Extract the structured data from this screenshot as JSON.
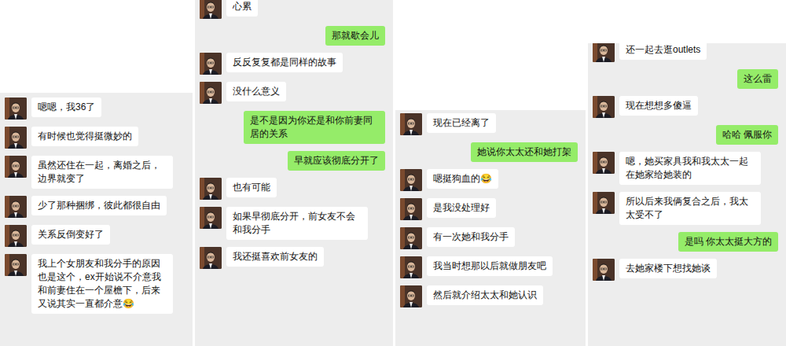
{
  "panels": [
    {
      "messages": [
        {
          "text": "嗯嗯，我36了",
          "kind": "received"
        },
        {
          "text": "有时候也觉得挺微妙的",
          "kind": "received"
        },
        {
          "text": "虽然还住在一起，离婚之后，边界就变了",
          "kind": "received"
        },
        {
          "text": "少了那种捆绑，彼此都很自由",
          "kind": "received"
        },
        {
          "text": "关系反倒变好了",
          "kind": "received"
        },
        {
          "text": "我上个女朋友和我分手的原因也是这个，ex开始说不介意我和前妻住在一个屋檐下，后来又说其实一直都介意😂",
          "kind": "received"
        }
      ]
    },
    {
      "messages": [
        {
          "text": "心累",
          "kind": "received"
        },
        {
          "text": "那就歇会儿",
          "kind": "sent"
        },
        {
          "text": "反反复复都是同样的故事",
          "kind": "received"
        },
        {
          "text": "没什么意义",
          "kind": "received"
        },
        {
          "text": "是不是因为你还是和你前妻同居的关系",
          "kind": "sent"
        },
        {
          "text": "早就应该彻底分开了",
          "kind": "sent"
        },
        {
          "text": "也有可能",
          "kind": "received"
        },
        {
          "text": "如果早彻底分开，前女友不会和我分手",
          "kind": "received"
        },
        {
          "text": "我还挺喜欢前女友的",
          "kind": "received"
        }
      ]
    },
    {
      "messages": [
        {
          "text": "现在已经离了",
          "kind": "received"
        },
        {
          "text": "她说你太太还和她打架",
          "kind": "sent"
        },
        {
          "text": "嗯挺狗血的😂",
          "kind": "received"
        },
        {
          "text": "是我没处理好",
          "kind": "received"
        },
        {
          "text": "有一次她和我分手",
          "kind": "received"
        },
        {
          "text": "我当时想那以后就做朋友吧",
          "kind": "received"
        },
        {
          "text": "然后就介绍太太和她认识",
          "kind": "received"
        }
      ]
    },
    {
      "messages": [
        {
          "text": "还一起去逛outlets",
          "kind": "received"
        },
        {
          "text": "这么雷",
          "kind": "sent"
        },
        {
          "text": "现在想想多傻逼",
          "kind": "received"
        },
        {
          "text": "哈哈 佩服你",
          "kind": "sent"
        },
        {
          "text": "嗯，她买家具我和我太太一起在她家给她装的",
          "kind": "received"
        },
        {
          "text": "所以后来我俩复合之后，我太太受不了",
          "kind": "received"
        },
        {
          "text": "是吗 你太太挺大方的",
          "kind": "sent"
        },
        {
          "text": "去她家楼下想找她谈",
          "kind": "received"
        }
      ]
    }
  ]
}
